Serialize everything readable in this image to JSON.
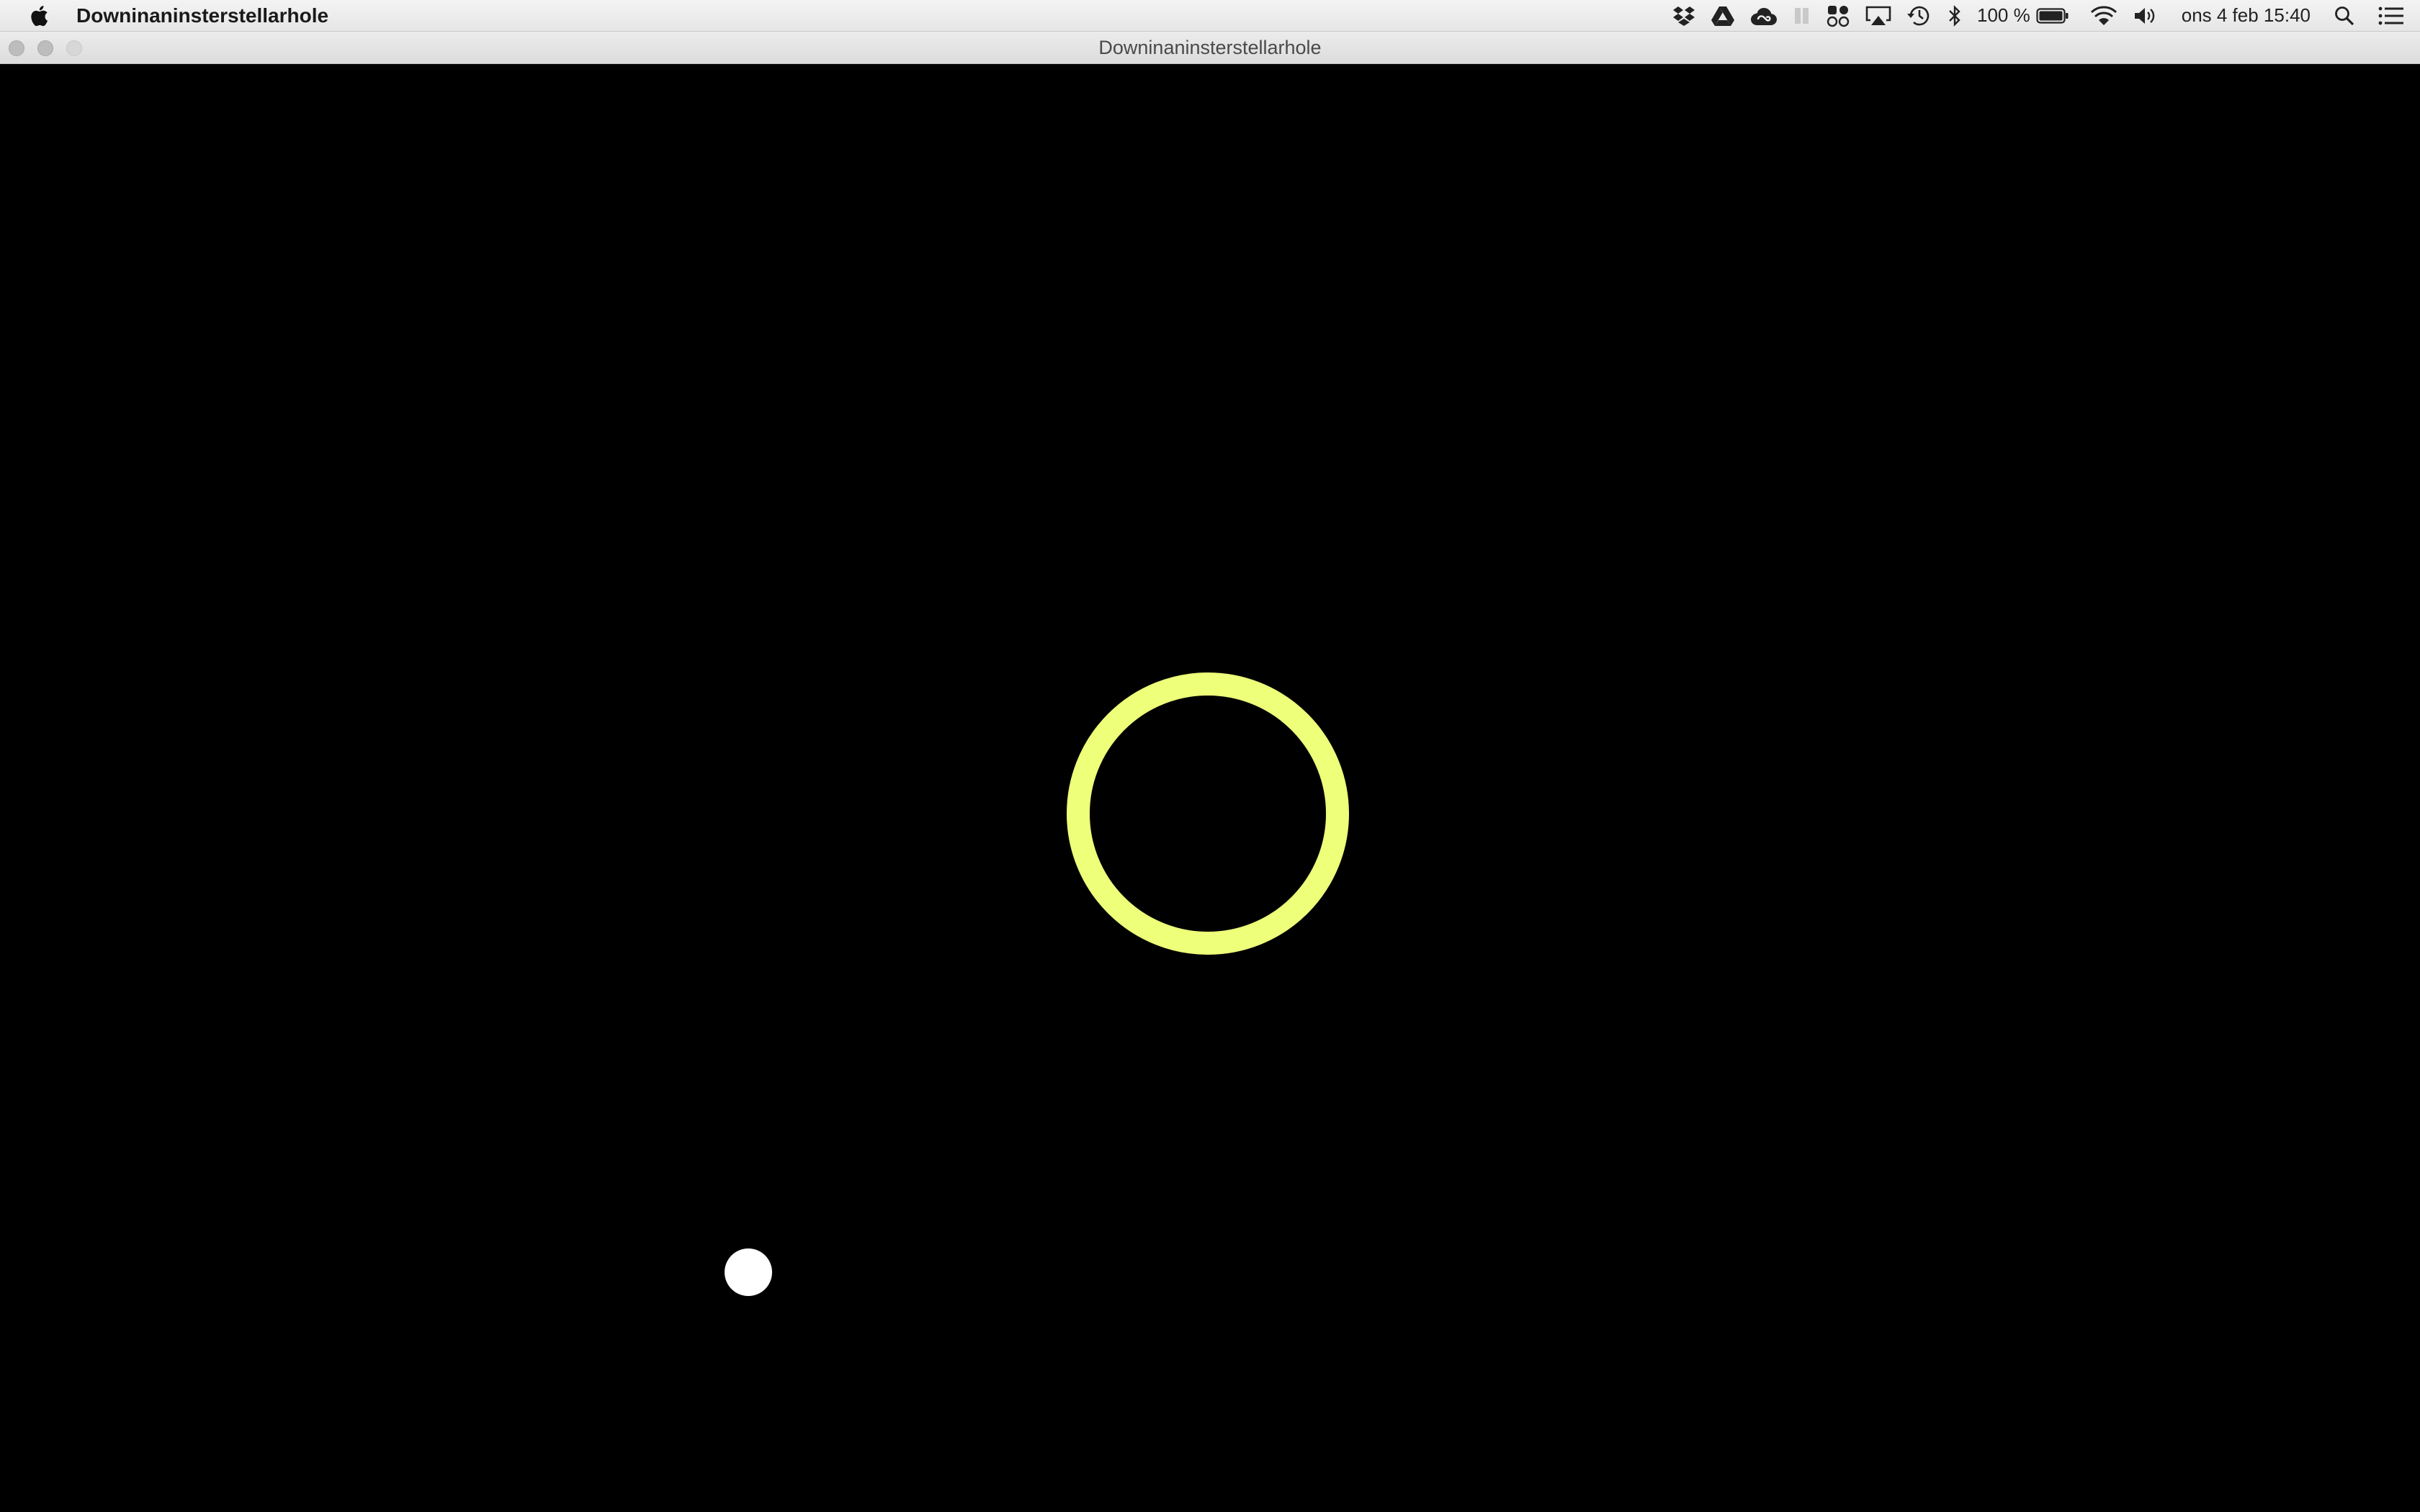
{
  "menubar": {
    "app_name": "Downinaninsterstellarhole",
    "battery_text": "100 %",
    "clock_text": "ons 4 feb  15:40",
    "status_icons": [
      "dropbox-icon",
      "google-drive-icon",
      "creative-cloud-icon",
      "app-indicator-icon",
      "cluster-icon",
      "airplay-icon",
      "time-machine-icon",
      "bluetooth-icon",
      "battery-icon",
      "wifi-icon",
      "volume-icon",
      "spotlight-icon",
      "notification-center-icon"
    ]
  },
  "window": {
    "title": "Downinaninsterstellarhole"
  },
  "game": {
    "background_color": "#000000",
    "ring_color": "#eeff7a",
    "ball_color": "#ffffff"
  }
}
